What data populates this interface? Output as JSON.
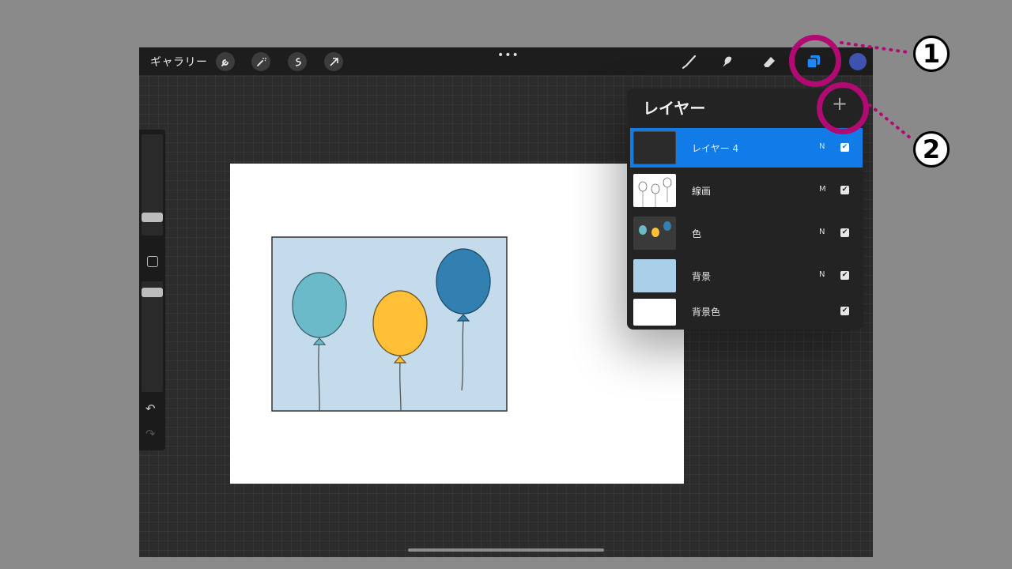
{
  "topbar": {
    "gallery_label": "ギャラリー",
    "more_label": "•••",
    "left_tools": [
      "wrench-icon",
      "magic-wand-icon",
      "selection-icon",
      "transform-arrow-icon"
    ],
    "right_tools": [
      "brush-icon",
      "smudge-icon",
      "eraser-icon",
      "layers-icon"
    ],
    "current_color": "#3f53b0"
  },
  "layers_panel": {
    "title": "レイヤー",
    "add_label": "+",
    "layers": [
      {
        "name": "レイヤー 4",
        "mode": "N",
        "visible": true,
        "selected": true
      },
      {
        "name": "線画",
        "mode": "M",
        "visible": true,
        "selected": false
      },
      {
        "name": "色",
        "mode": "N",
        "visible": true,
        "selected": false
      },
      {
        "name": "背景",
        "mode": "N",
        "visible": true,
        "selected": false
      },
      {
        "name": "背景色",
        "mode": "",
        "visible": true,
        "selected": false
      }
    ]
  },
  "annotations": {
    "one": "1",
    "two": "2",
    "color": "#b10a73"
  },
  "artwork": {
    "background_color": "#c3dbea",
    "balloon_colors": [
      "#6bbac9",
      "#ffbf36",
      "#3280b1"
    ]
  }
}
